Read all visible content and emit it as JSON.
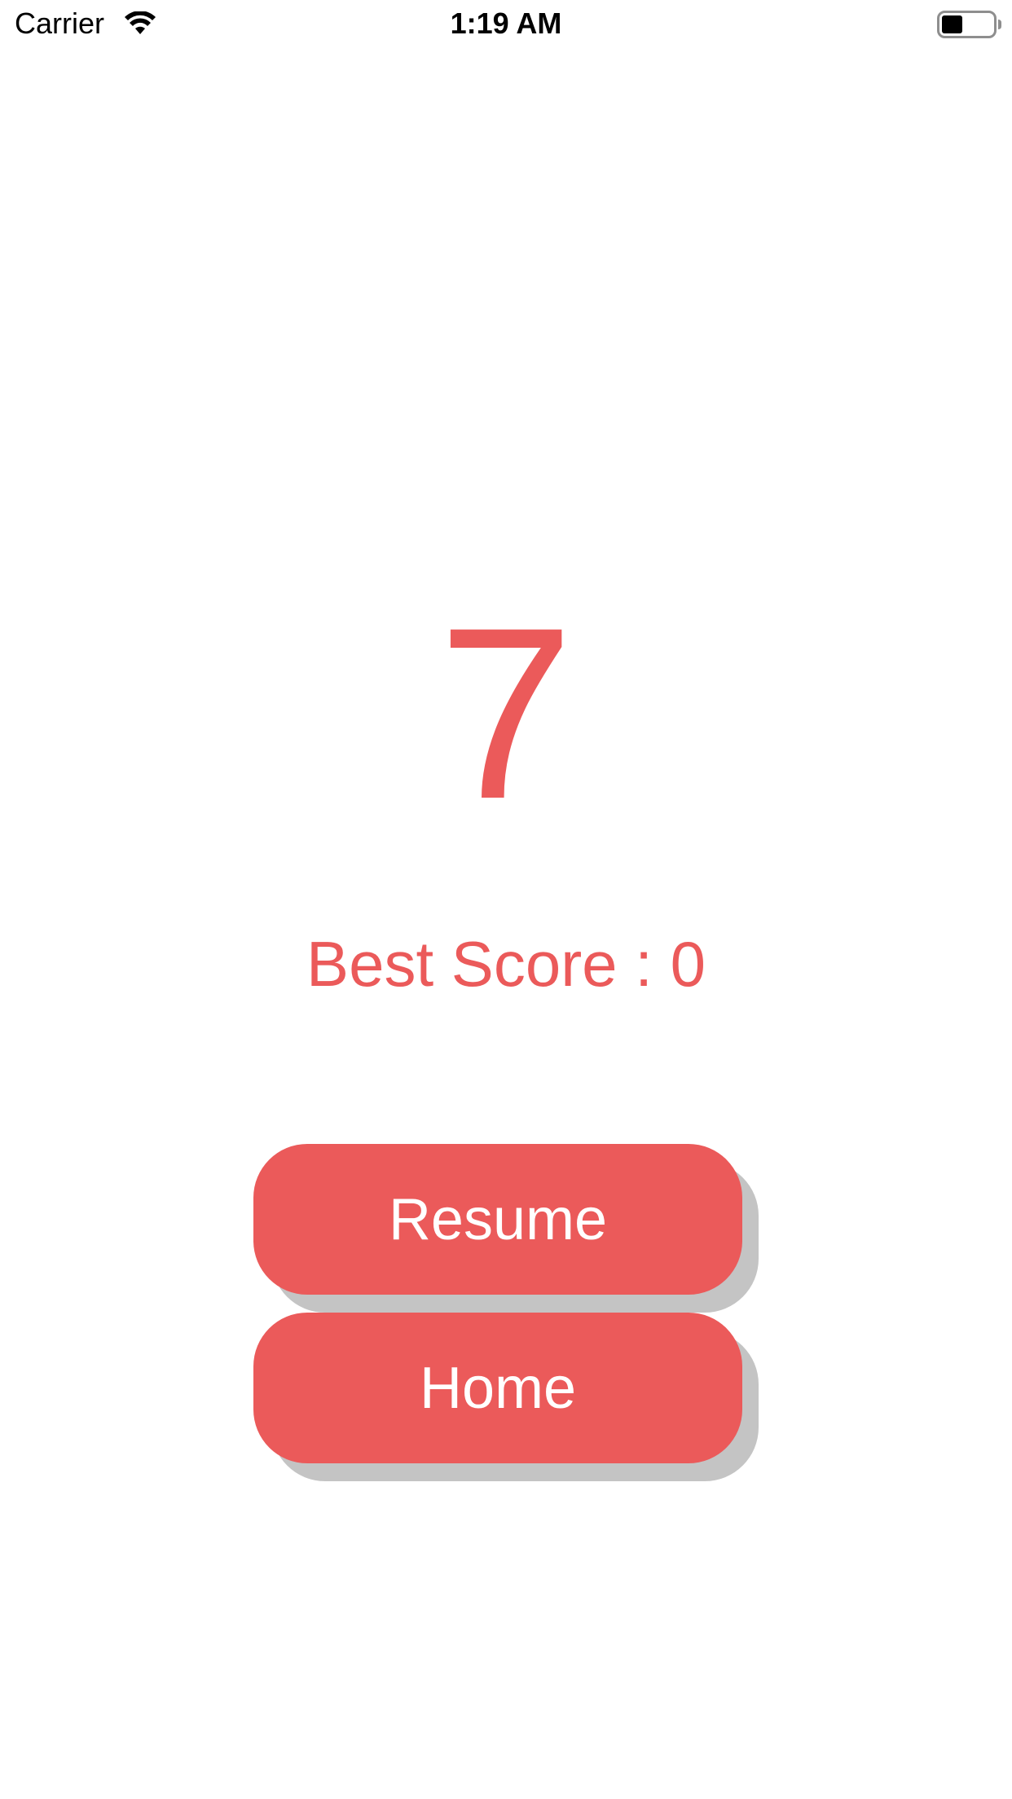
{
  "status_bar": {
    "carrier": "Carrier",
    "time": "1:19 AM",
    "wifi_icon": "wifi-icon",
    "battery_icon": "battery-icon",
    "battery_level": 0.4
  },
  "game": {
    "score": "7",
    "best_score_label": "Best Score : 0"
  },
  "buttons": {
    "resume_label": "Resume",
    "home_label": "Home"
  },
  "colors": {
    "accent": "#EB5A5A",
    "button_shadow": "#C4C4C4",
    "background": "#FFFFFF",
    "button_text": "#FFFFFF"
  }
}
